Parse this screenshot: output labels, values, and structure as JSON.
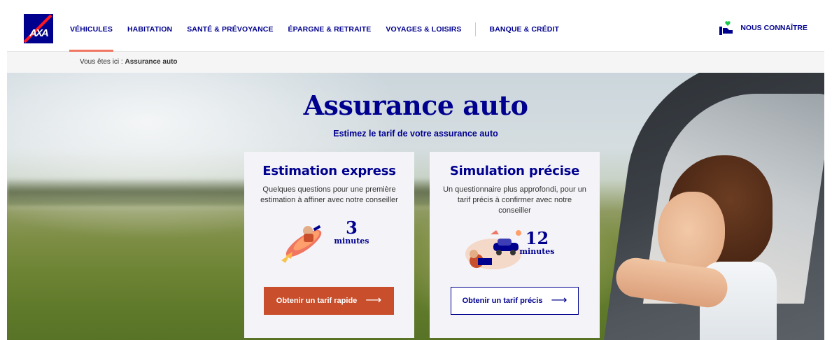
{
  "brand": {
    "logo_text": "AXA"
  },
  "nav": {
    "items": [
      {
        "label": "VÉHICULES",
        "active": true
      },
      {
        "label": "HABITATION",
        "active": false
      },
      {
        "label": "SANTÉ & PRÉVOYANCE",
        "active": false
      },
      {
        "label": "ÉPARGNE & RETRAITE",
        "active": false
      },
      {
        "label": "VOYAGES & LOISIRS",
        "active": false
      },
      {
        "label": "BANQUE & CRÉDIT",
        "active": false
      }
    ],
    "about": {
      "label": "NOUS CONNAÎTRE",
      "icon": "hand-heart-icon"
    }
  },
  "breadcrumb": {
    "prefix": "Vous êtes ici : ",
    "current": "Assurance auto"
  },
  "hero": {
    "title": "Assurance auto",
    "subtitle": "Estimez le tarif de votre assurance auto"
  },
  "cards": {
    "express": {
      "title": "Estimation express",
      "description": "Quelques questions pour une première estimation à affiner avec notre conseiller",
      "minutes_number": "3",
      "minutes_label": "minutes",
      "illustration": "rocket-rider-icon",
      "button_label": "Obtenir un tarif rapide",
      "button_color": "#c84e2c"
    },
    "precise": {
      "title": "Simulation précise",
      "description": "Un questionnaire plus approfondi, pour un tarif précis à confirmer avec notre conseiller",
      "minutes_number": "12",
      "minutes_label": "minutes",
      "illustration": "car-mechanic-icon",
      "button_label": "Obtenir un tarif précis",
      "button_color": "#00008f"
    }
  },
  "colors": {
    "brand_blue": "#00008f",
    "accent_red": "#ff1721",
    "active_underline": "#f07662"
  }
}
